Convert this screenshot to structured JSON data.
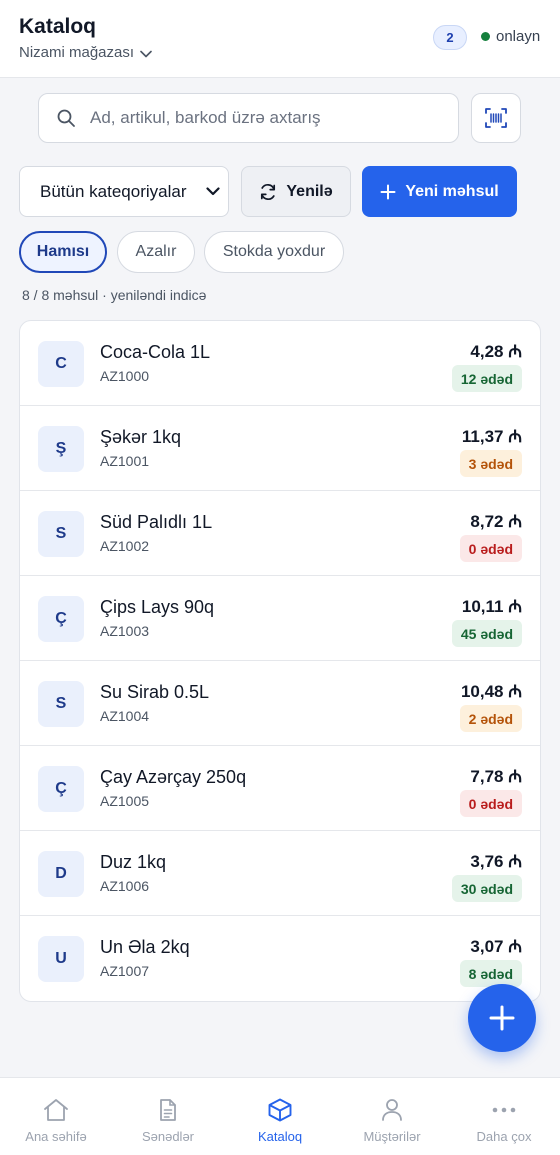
{
  "header": {
    "title": "Kataloq",
    "store_name": "Nizami mağazası",
    "pending_count": "2",
    "status_label": "onlayn",
    "status_color": "#15803d"
  },
  "search": {
    "placeholder": "Ad, artikul, barkod üzrə axtarış",
    "value": "",
    "search_icon": "search-icon",
    "scan_icon": "barcode-scan-icon"
  },
  "toolbar": {
    "category_selected": "Bütün kateqoriyalar",
    "refresh_label": "Yenilə",
    "new_product_label": "Yeni məhsul",
    "accent_color": "#2563eb"
  },
  "filters": {
    "all": "Hamısı",
    "low": "Azalır",
    "out_of_stock": "Stokda yoxdur",
    "active": "all"
  },
  "summary": "8 / 8 məhsul · yeniləndi indicə",
  "products": [
    {
      "initial": "C",
      "name": "Coca-Cola 1L",
      "sku": "AZ1000",
      "price": "4,28 ₼",
      "stock": "12 ədəd",
      "stock_status": "good"
    },
    {
      "initial": "Ş",
      "name": "Şəkər 1kq",
      "sku": "AZ1001",
      "price": "11,37 ₼",
      "stock": "3 ədəd",
      "stock_status": "low"
    },
    {
      "initial": "S",
      "name": "Süd Palıdlı 1L",
      "sku": "AZ1002",
      "price": "8,72 ₼",
      "stock": "0 ədəd",
      "stock_status": "out"
    },
    {
      "initial": "Ç",
      "name": "Çips Lays 90q",
      "sku": "AZ1003",
      "price": "10,11 ₼",
      "stock": "45 ədəd",
      "stock_status": "good"
    },
    {
      "initial": "S",
      "name": "Su Sirab 0.5L",
      "sku": "AZ1004",
      "price": "10,48 ₼",
      "stock": "2 ədəd",
      "stock_status": "low"
    },
    {
      "initial": "Ç",
      "name": "Çay Azərçay 250q",
      "sku": "AZ1005",
      "price": "7,78 ₼",
      "stock": "0 ədəd",
      "stock_status": "out"
    },
    {
      "initial": "D",
      "name": "Duz 1kq",
      "sku": "AZ1006",
      "price": "3,76 ₼",
      "stock": "30 ədəd",
      "stock_status": "good"
    },
    {
      "initial": "U",
      "name": "Un Əla 2kq",
      "sku": "AZ1007",
      "price": "3,07 ₼",
      "stock": "8 ədəd",
      "stock_status": "good"
    }
  ],
  "nav": [
    {
      "label": "Ana səhifə",
      "icon": "home-icon",
      "active": false
    },
    {
      "label": "Sənədlər",
      "icon": "document-icon",
      "active": false
    },
    {
      "label": "Kataloq",
      "icon": "box-icon",
      "active": true
    },
    {
      "label": "Müştərilər",
      "icon": "user-icon",
      "active": false
    },
    {
      "label": "Daha çox",
      "icon": "more-dots-icon",
      "active": false
    }
  ]
}
